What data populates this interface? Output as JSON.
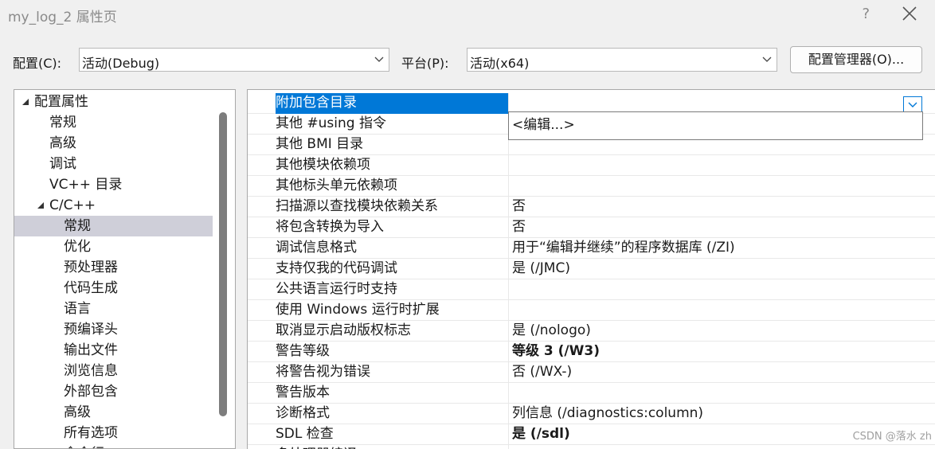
{
  "window": {
    "title": "my_log_2 属性页",
    "help_label": "?"
  },
  "config": {
    "config_label": "配置(C):",
    "config_value": "活动(Debug)",
    "platform_label": "平台(P):",
    "platform_value": "活动(x64)",
    "manager_button": "配置管理器(O)..."
  },
  "tree": [
    {
      "label": "配置属性",
      "level": 0,
      "expanded": true,
      "selected": false
    },
    {
      "label": "常规",
      "level": 1,
      "selected": false
    },
    {
      "label": "高级",
      "level": 1,
      "selected": false
    },
    {
      "label": "调试",
      "level": 1,
      "selected": false
    },
    {
      "label": "VC++ 目录",
      "level": 1,
      "selected": false
    },
    {
      "label": "C/C++",
      "level": 1,
      "expanded": true,
      "selected": false
    },
    {
      "label": "常规",
      "level": 2,
      "selected": true
    },
    {
      "label": "优化",
      "level": 2,
      "selected": false
    },
    {
      "label": "预处理器",
      "level": 2,
      "selected": false
    },
    {
      "label": "代码生成",
      "level": 2,
      "selected": false
    },
    {
      "label": "语言",
      "level": 2,
      "selected": false
    },
    {
      "label": "预编译头",
      "level": 2,
      "selected": false
    },
    {
      "label": "输出文件",
      "level": 2,
      "selected": false
    },
    {
      "label": "浏览信息",
      "level": 2,
      "selected": false
    },
    {
      "label": "外部包含",
      "level": 2,
      "selected": false
    },
    {
      "label": "高级",
      "level": 2,
      "selected": false
    },
    {
      "label": "所有选项",
      "level": 2,
      "selected": false
    },
    {
      "label": "命令行",
      "level": 2,
      "selected": false
    }
  ],
  "properties": [
    {
      "name": "附加包含目录",
      "value": "",
      "bold": false,
      "selected": true
    },
    {
      "name": "其他 #using 指令",
      "value": "",
      "bold": false
    },
    {
      "name": "其他 BMI 目录",
      "value": "",
      "bold": false
    },
    {
      "name": "其他模块依赖项",
      "value": "",
      "bold": false
    },
    {
      "name": "其他标头单元依赖项",
      "value": "",
      "bold": false
    },
    {
      "name": "扫描源以查找模块依赖关系",
      "value": "否",
      "bold": false
    },
    {
      "name": "将包含转换为导入",
      "value": "否",
      "bold": false
    },
    {
      "name": "调试信息格式",
      "value": "用于“编辑并继续”的程序数据库 (/ZI)",
      "bold": false
    },
    {
      "name": "支持仅我的代码调试",
      "value": "是 (/JMC)",
      "bold": false
    },
    {
      "name": "公共语言运行时支持",
      "value": "",
      "bold": false
    },
    {
      "name": "使用 Windows 运行时扩展",
      "value": "",
      "bold": false
    },
    {
      "name": "取消显示启动版权标志",
      "value": "是 (/nologo)",
      "bold": false
    },
    {
      "name": "警告等级",
      "value": "等级 3 (/W3)",
      "bold": true
    },
    {
      "name": "将警告视为错误",
      "value": "否 (/WX-)",
      "bold": false
    },
    {
      "name": "警告版本",
      "value": "",
      "bold": false
    },
    {
      "name": "诊断格式",
      "value": "列信息 (/diagnostics:column)",
      "bold": false
    },
    {
      "name": "SDL 检查",
      "value": "是 (/sdl)",
      "bold": true
    },
    {
      "name": "多处理器编译",
      "value": "",
      "bold": false
    }
  ],
  "dropdown": {
    "option": "<编辑...>"
  },
  "watermark": "CSDN @落水 zh"
}
